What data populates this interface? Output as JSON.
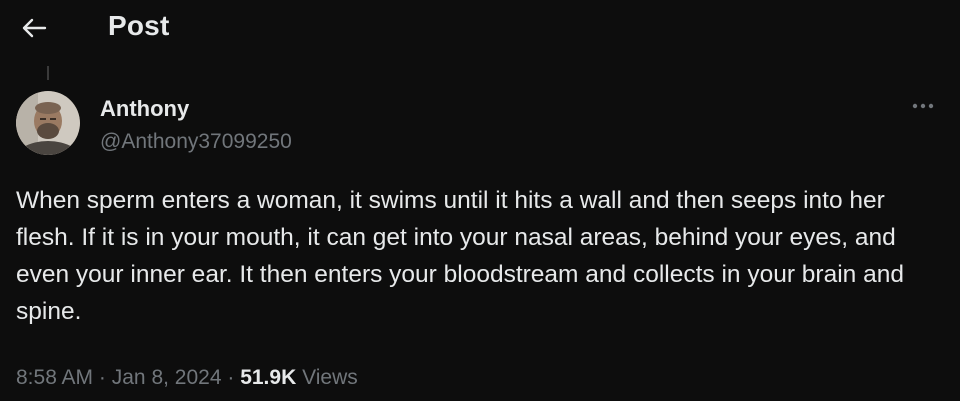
{
  "header": {
    "title": "Post",
    "back_icon": "arrow-left-icon"
  },
  "post": {
    "author_name": "Anthony",
    "author_handle": "@Anthony37099250",
    "more_icon": "more-horizontal-icon",
    "text": "When sperm enters a woman, it swims until it hits a wall and then seeps into her flesh. If it is in your mouth, it can get into your nasal areas, behind your eyes, and even your inner ear. It then enters your bloodstream and collects in your brain and spine.",
    "time": "8:58 AM",
    "separator": "·",
    "date": "Jan 8, 2024",
    "views_count": "51.9K",
    "views_label": "Views"
  },
  "colors": {
    "background": "#0d0d0d",
    "primary_text": "#e7e9ea",
    "secondary_text": "#71767b"
  }
}
